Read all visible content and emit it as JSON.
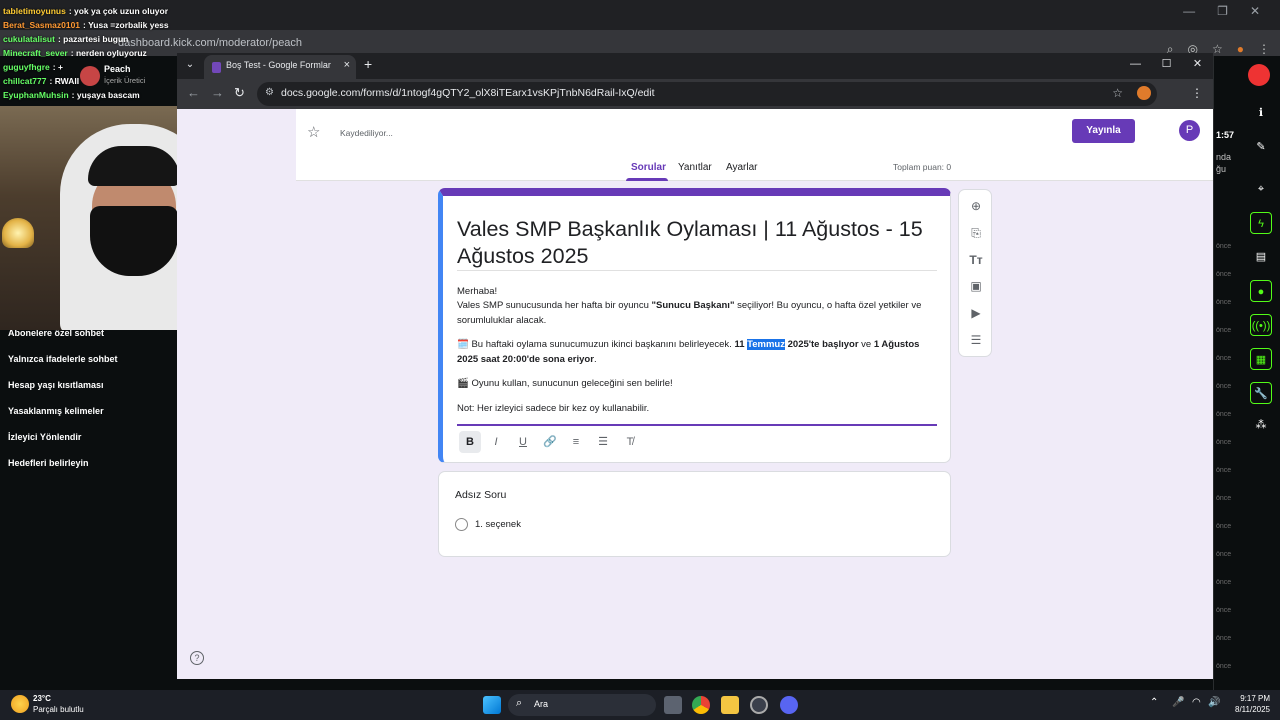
{
  "chat": [
    {
      "user": "tabletimoyunus",
      "color": "#ffcc33",
      "text": "yok ya çok uzun oluyor"
    },
    {
      "user": "Berat_Sasmaz0101",
      "color": "#ff9933",
      "text": "Yusa =zorbalik yess"
    },
    {
      "user": "cukulatalisut",
      "color": "#66ff66",
      "text": "pazartesi bugun"
    },
    {
      "user": "Minecraft_sever",
      "color": "#66ff66",
      "text": "nerden oyluyoruz"
    },
    {
      "user": "guguyfhgre",
      "color": "#66ff66",
      "text": "+"
    },
    {
      "user": "chillcat777",
      "color": "#66ff66",
      "text": "RWAII"
    },
    {
      "user": "EyuphanMuhsin",
      "color": "#66ff66",
      "text": "yuşaya bascam"
    }
  ],
  "kick": {
    "bg_url": "dashboard.kick.com/moderator/peach",
    "profile_name": "Peach",
    "profile_role": "İçerik Üretici",
    "left_menu": [
      "Abonelere özel sohbet",
      "Yalnızca ifadelerle sohbet",
      "Hesap yaşı kısıtlaması",
      "Yasaklanmış kelimeler",
      "İzleyici Yönlendir",
      "Hedefleri belirleyin"
    ],
    "right_time": "1:57",
    "right_texts": [
      "nda",
      "ğu"
    ],
    "right_muted": [
      "önce",
      "önce",
      "önce",
      "önce",
      "önce",
      "önce",
      "önce",
      "önce",
      "önce",
      "önce",
      "önce",
      "önce",
      "önce",
      "önce",
      "önce",
      "önce",
      "önce",
      "önce"
    ]
  },
  "browser": {
    "tab_title": "Boş Test - Google Formlar",
    "url": "docs.google.com/forms/d/1ntogf4gQTY2_olX8iTEarx1vsKPjTnbN6dRail-IxQ/edit",
    "icons": {
      "back": "arrow-left-icon",
      "forward": "arrow-right-icon",
      "reload": "reload-icon",
      "site": "site-settings-icon",
      "bookmark": "star-icon",
      "menu": "kebab-menu-icon"
    }
  },
  "forms": {
    "saving": "Kaydediliyor...",
    "publish": "Yayınla",
    "avatar": "P",
    "tabs": [
      "Sorular",
      "Yanıtlar",
      "Ayarlar"
    ],
    "points": "Toplam puan: 0",
    "accent": "#673ab7",
    "title": "Vales SMP Başkanlık Oylaması | 11 Ağustos - 15 Ağustos 2025",
    "desc": {
      "l1": "Merhaba!",
      "l2a": "Vales SMP sunucusunda her hafta bir oyuncu ",
      "l2b": "\"Sunucu Başkanı\"",
      "l2c": " seçiliyor! Bu oyuncu, o hafta özel yetkiler ve sorumluluklar alacak.",
      "l3a": "🗓️ Bu haftaki oylama sunucumuzun ikinci başkanını belirleyecek. ",
      "l3b": "11 ",
      "l3c": "Temmuz",
      "l3d": " 2025'te başlıyor",
      "l3e": " ve ",
      "l3f": "1 Ağustos 2025 saat 20:00'de sona eriyor",
      "l3g": ".",
      "l4": "🎬 Oyunu kullan, sunucunun geleceğini sen belirle!",
      "l5": "Not: Her izleyici sadece bir kez oy kullanabilir."
    },
    "format_buttons": [
      "B",
      "I",
      "U",
      "🔗",
      "≡",
      "☰",
      "T̸"
    ],
    "question_title": "Adsız Soru",
    "option": "1. seçenek"
  },
  "taskbar": {
    "temp": "23°C",
    "weather": "Parçalı bulutlu",
    "search": "Ara",
    "time": "9:17 PM",
    "date": "8/11/2025"
  }
}
